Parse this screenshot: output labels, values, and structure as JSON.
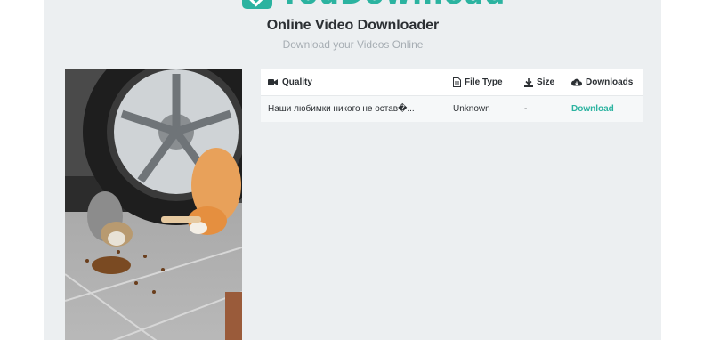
{
  "brand": {
    "name": "YouDownload",
    "accent": "#2bb3a0"
  },
  "page": {
    "title": "Online Video Downloader",
    "subtitle": "Download your Videos Online"
  },
  "table": {
    "headers": {
      "quality": "Quality",
      "file_type": "File Type",
      "size": "Size",
      "downloads": "Downloads"
    },
    "header_icons": [
      "video-camera-icon",
      "file-icon",
      "download-icon",
      "cloud-download-icon"
    ],
    "rows": [
      {
        "quality": "Наши любимки никого не остав�...",
        "file_type": "Unknown",
        "size": "-",
        "download": "Download"
      }
    ]
  },
  "thumbnail": {
    "description": "video-thumbnail"
  }
}
